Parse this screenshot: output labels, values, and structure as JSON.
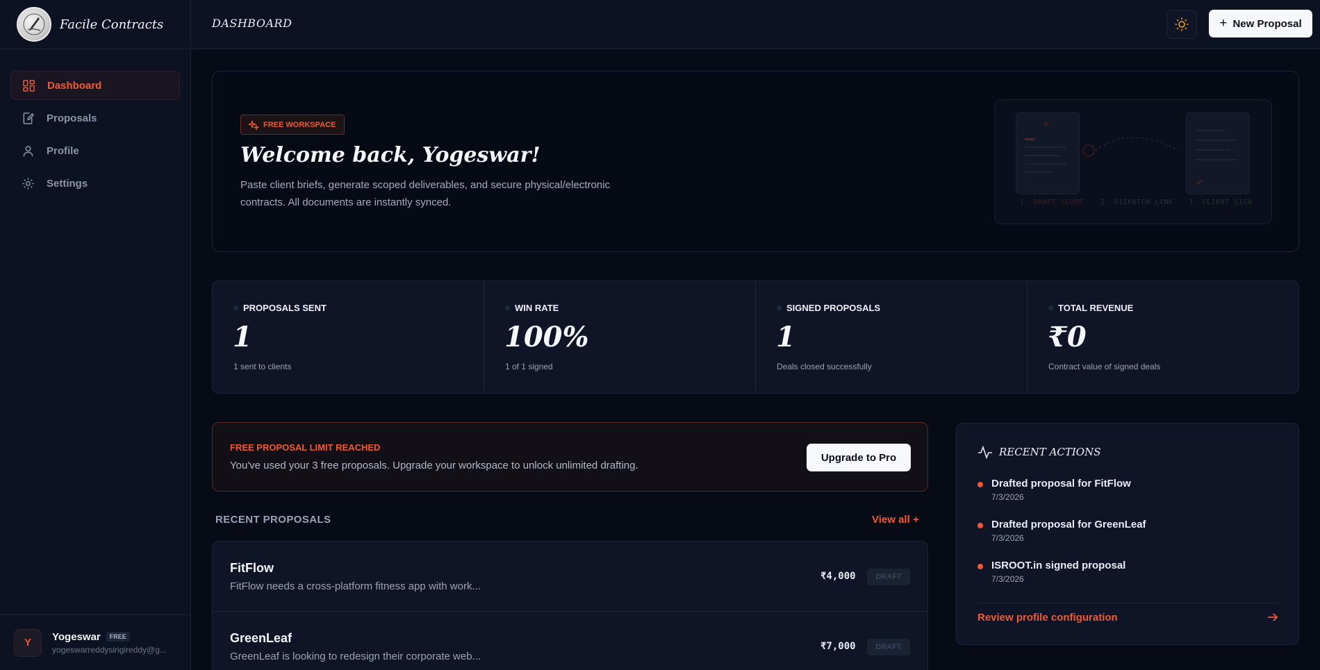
{
  "brand": {
    "name": "Facile Contracts"
  },
  "sidebar": {
    "items": [
      {
        "label": "Dashboard"
      },
      {
        "label": "Proposals"
      },
      {
        "label": "Profile"
      },
      {
        "label": "Settings"
      }
    ],
    "user": {
      "initial": "Y",
      "name": "Yogeswar",
      "plan": "FREE",
      "email": "yogeswarreddysirigireddy@g..."
    }
  },
  "header": {
    "title": "DASHBOARD",
    "new_proposal_label": "New Proposal"
  },
  "welcome": {
    "badge": "FREE WORKSPACE",
    "title": "Welcome back, Yogeswar!",
    "description": "Paste client briefs, generate scoped deliverables, and secure physical/electronic contracts. All documents are instantly synced.",
    "steps": [
      "1. DRAFT SCOPE",
      "2. DISPATCH LINK",
      "3. CLIENT SIGN"
    ]
  },
  "stats": [
    {
      "label": "PROPOSALS SENT",
      "value": "1",
      "sub": "1 sent to clients"
    },
    {
      "label": "WIN RATE",
      "value": "100%",
      "sub": "1 of 1 signed"
    },
    {
      "label": "SIGNED PROPOSALS",
      "value": "1",
      "sub": "Deals closed successfully"
    },
    {
      "label": "TOTAL REVENUE",
      "value": "₹0",
      "sub": "Contract value of signed deals"
    }
  ],
  "limit": {
    "title": "FREE PROPOSAL LIMIT REACHED",
    "text": "You've used your 3 free proposals. Upgrade your workspace to unlock unlimited drafting.",
    "button": "Upgrade to Pro"
  },
  "recent_proposals": {
    "heading": "RECENT PROPOSALS",
    "view_all": "View all",
    "rows": [
      {
        "name": "FitFlow",
        "desc": "FitFlow needs a cross-platform fitness app with work...",
        "amount": "₹4,000",
        "status": "DRAFT"
      },
      {
        "name": "GreenLeaf",
        "desc": "GreenLeaf is looking to redesign their corporate web...",
        "amount": "₹7,000",
        "status": "DRAFT"
      }
    ]
  },
  "recent_actions": {
    "heading": "RECENT ACTIONS",
    "items": [
      {
        "title": "Drafted proposal for FitFlow",
        "date": "7/3/2026"
      },
      {
        "title": "Drafted proposal for GreenLeaf",
        "date": "7/3/2026"
      },
      {
        "title": "ISROOT.in signed proposal",
        "date": "7/3/2026"
      }
    ],
    "review_link": "Review profile configuration"
  },
  "colors": {
    "accent": "#ef5a34",
    "background": "#070b16",
    "panel": "#0f1526",
    "sidebar": "#0c1222"
  },
  "icons": {
    "nav": [
      "dashboard-grid-icon",
      "proposal-edit-icon",
      "user-icon",
      "gear-icon"
    ],
    "theme": "sun-icon",
    "badge": "sparkle-icon",
    "actions": "activity-pulse-icon",
    "review": "arrow-right-icon"
  }
}
